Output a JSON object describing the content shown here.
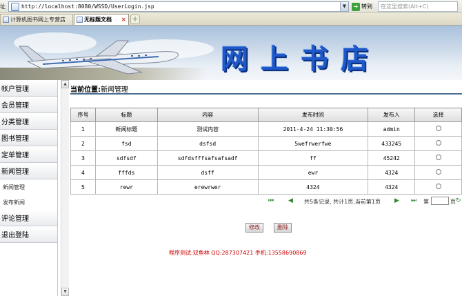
{
  "browser": {
    "addr_label": "址",
    "url": "http://localhost:8080/WSSD/UserLogin.jsp",
    "go_label": "转到",
    "search_placeholder": "在这里搜索(Alt+C)",
    "tabs": [
      {
        "label": "计算机图书网上专营店",
        "active": false
      },
      {
        "label": "无标题文档",
        "active": true
      }
    ]
  },
  "banner": {
    "title": "网上书店",
    "brand_color": "#1f58c9"
  },
  "sidebar": {
    "items": [
      {
        "label": "帐户管理"
      },
      {
        "label": "会员管理"
      },
      {
        "label": "分类管理"
      },
      {
        "label": "图书管理"
      },
      {
        "label": "定单管理"
      },
      {
        "label": "新闻管理"
      }
    ],
    "sub_items": [
      {
        "label": "新闻管理"
      },
      {
        "label": "发布新闻"
      }
    ],
    "bottom_items": [
      {
        "label": "评论管理"
      },
      {
        "label": "退出登陆"
      }
    ]
  },
  "location": {
    "label": "当前位置",
    "sep": ":",
    "value": "新闻管理"
  },
  "table": {
    "headers": [
      "序号",
      "标题",
      "内容",
      "发布时间",
      "发布人",
      "选择"
    ],
    "rows": [
      {
        "no": "1",
        "title": "新闻标题",
        "content": "测试内容",
        "time": "2011-4-24 11:30:56",
        "author": "admin"
      },
      {
        "no": "2",
        "title": "fsd",
        "content": "dsfsd",
        "time": "5wefrwerfwe",
        "author": "433245"
      },
      {
        "no": "3",
        "title": "sdfsdf",
        "content": "sdfdsfffsafsafsadf",
        "time": "ff",
        "author": "45242"
      },
      {
        "no": "4",
        "title": "fffds",
        "content": "dsff",
        "time": "ewr",
        "author": "4324"
      },
      {
        "no": "5",
        "title": "rewr",
        "content": "erewrwer",
        "time": "4324",
        "author": "4324"
      }
    ]
  },
  "pager": {
    "info": "共5条记录, 共计1页,当前第1页",
    "jump_label": "第",
    "unit": "页"
  },
  "buttons": {
    "edit": "修改",
    "delete": "删除"
  },
  "footer": "程序测试:双鱼林 QQ:287307421 手机:13558690869"
}
